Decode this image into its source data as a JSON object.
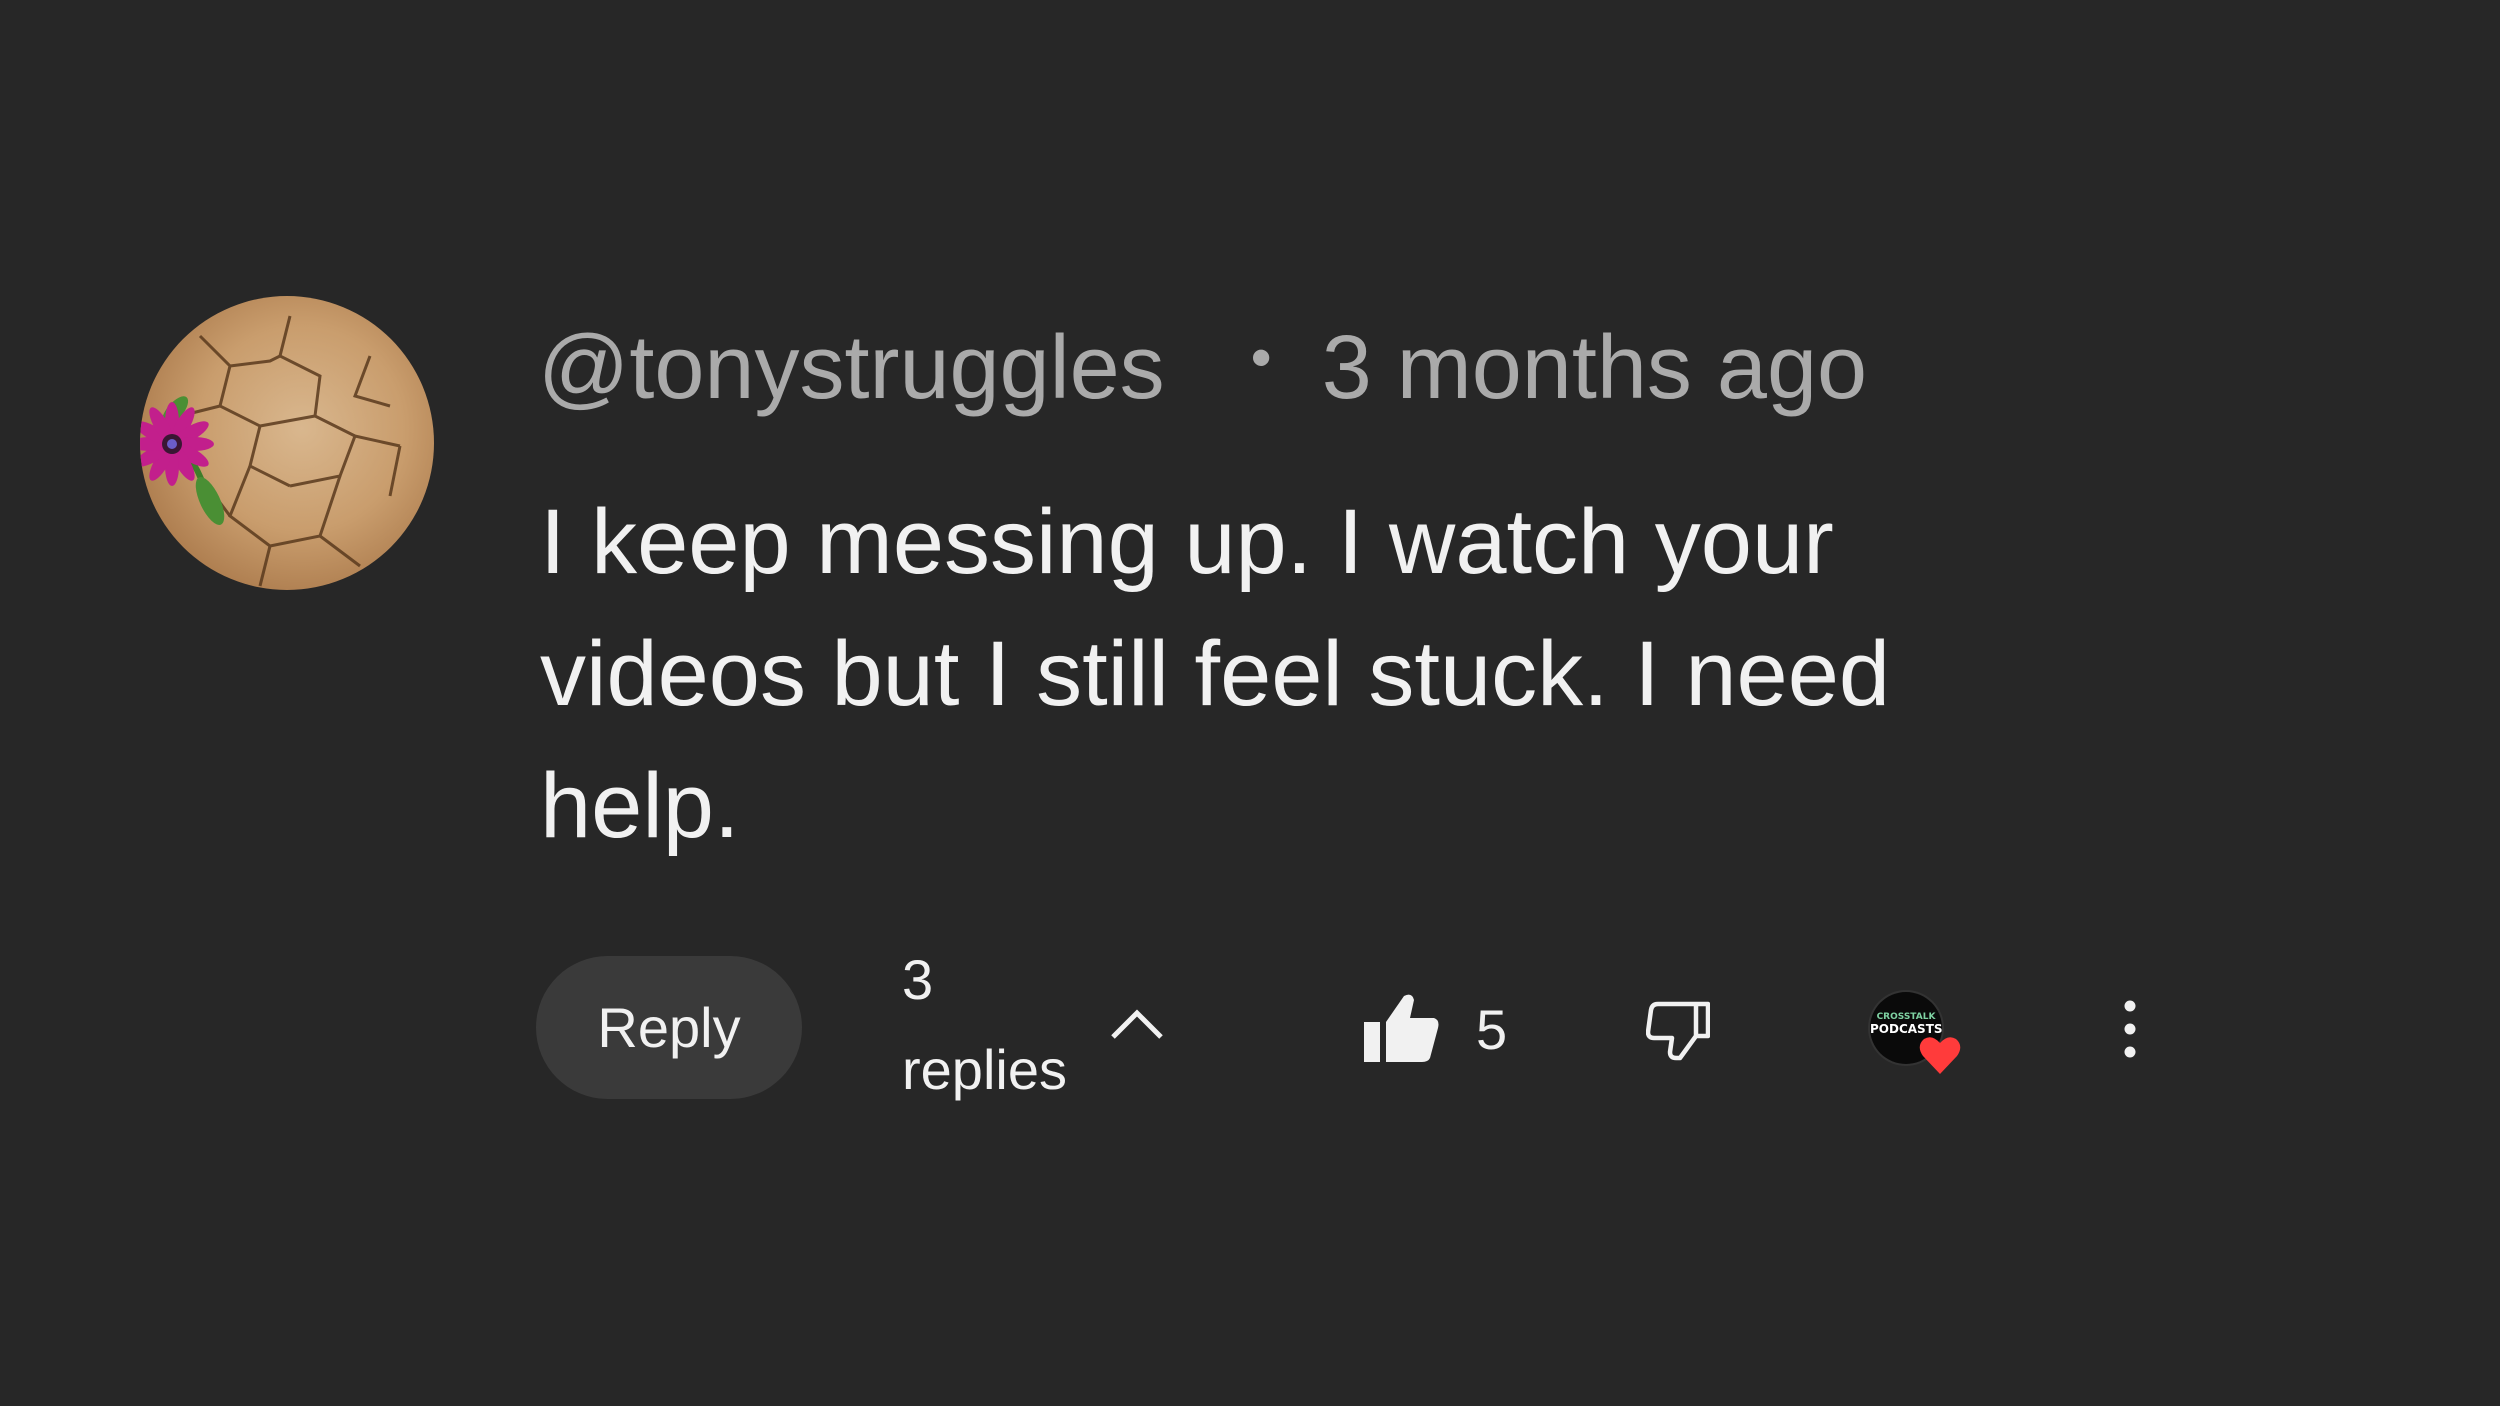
{
  "comment": {
    "author_handle": "@tonystruggles",
    "separator": "•",
    "timestamp": "3 months ago",
    "text": "I keep messing up. I watch your videos but I still feel stuck. I need help."
  },
  "actions": {
    "reply_label": "Reply",
    "replies_label": "3 replies",
    "like_count": "5",
    "creator_avatar_text": [
      "CROSSTALK",
      "PODCASTS"
    ]
  },
  "icons": {
    "avatar": "avatar-flower-cracked-earth",
    "replies_toggle": "chevron-up-icon",
    "like": "thumbs-up-icon",
    "dislike": "thumbs-down-icon",
    "creator_heart": "heart-icon",
    "more": "more-vertical-icon"
  },
  "colors": {
    "background": "#272727",
    "meta_text": "#aaaaaa",
    "body_text": "#f1f1f1",
    "reply_button_bg": "#3a3a3a",
    "heart": "#ff3b3b"
  }
}
